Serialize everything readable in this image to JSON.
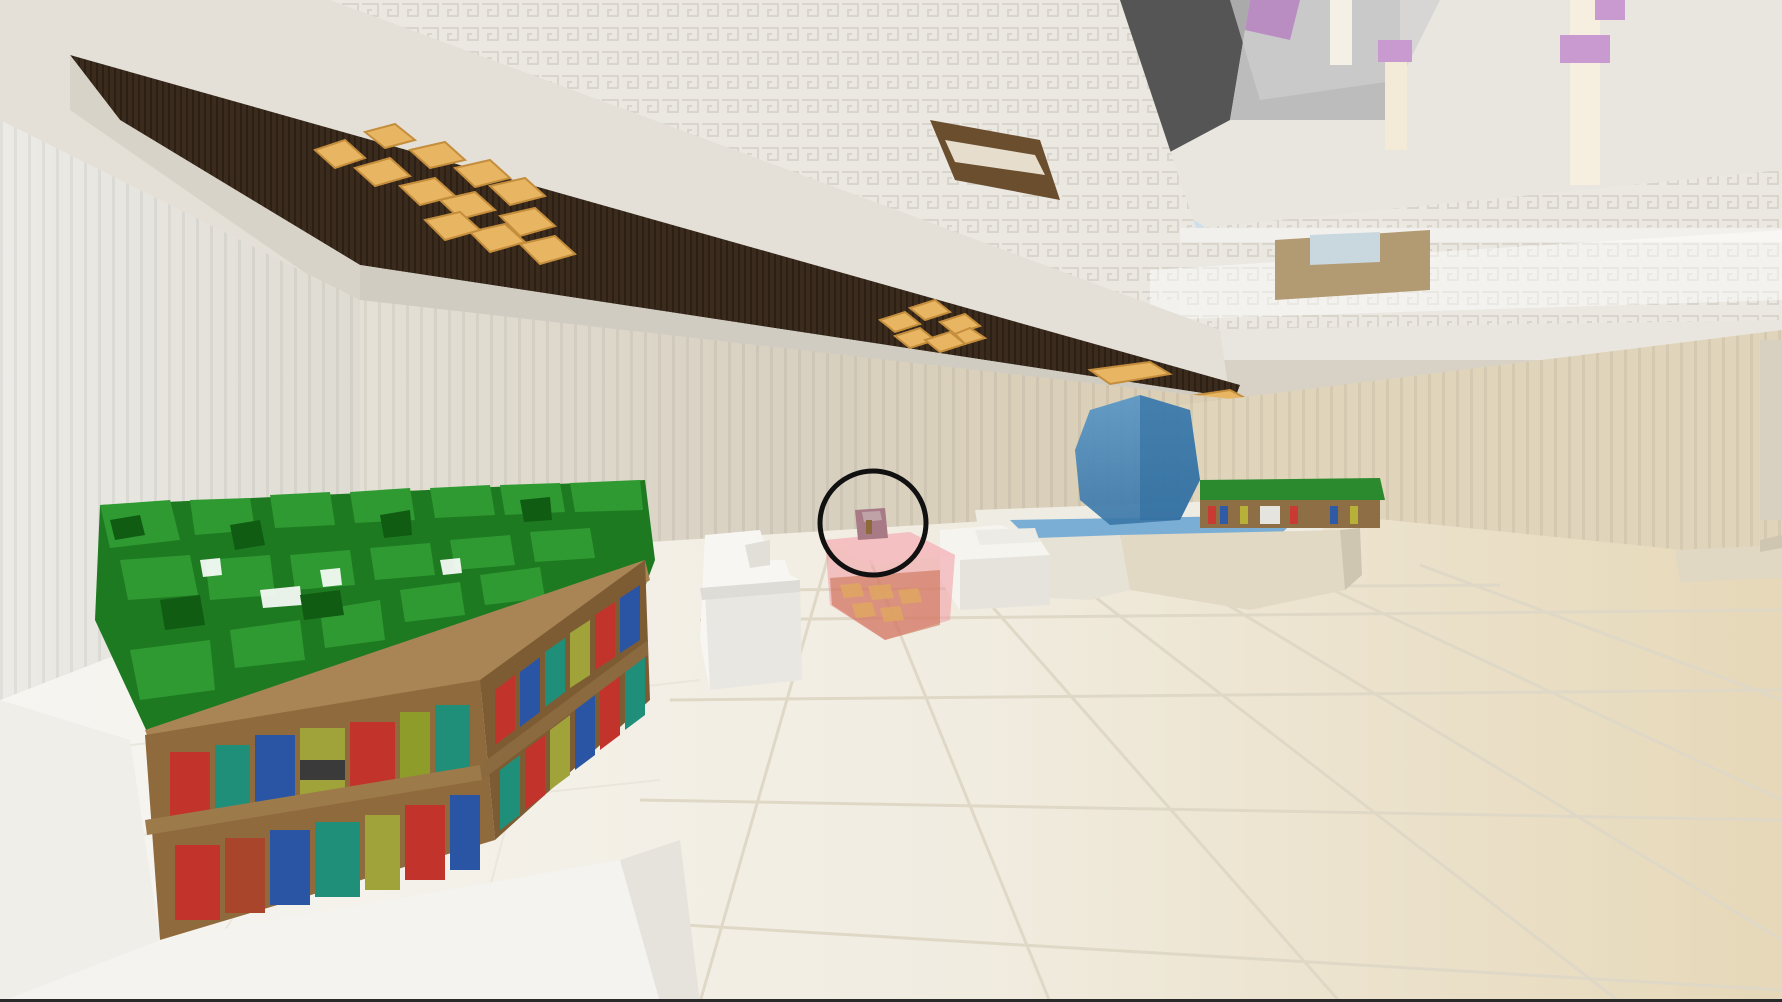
{
  "scene": {
    "type": "voxel-game-first-person-view",
    "colors": {
      "ceiling": "#3a2a1c",
      "ceiling_trim": "#e6e2d8",
      "lamp": "#e9b865",
      "wall_light": "#e8e4da",
      "wall_shadow": "#cfc8b8",
      "floor_white": "#f3f1eb",
      "floor_cream": "#eadfc6",
      "leaves": "#1f7d22",
      "bookshelf_wood": "#9a7a4e",
      "water": "#4a86b8",
      "glass_pink": "#f0a0a6",
      "highlight_ring": "#111111"
    },
    "objects": [
      "ceiling-lamp",
      "upper-balcony",
      "bookshelf-planter",
      "white-sofa",
      "pink-glass-table",
      "potted-item",
      "water-fountain",
      "distant-bookshelf",
      "chandelier"
    ]
  }
}
